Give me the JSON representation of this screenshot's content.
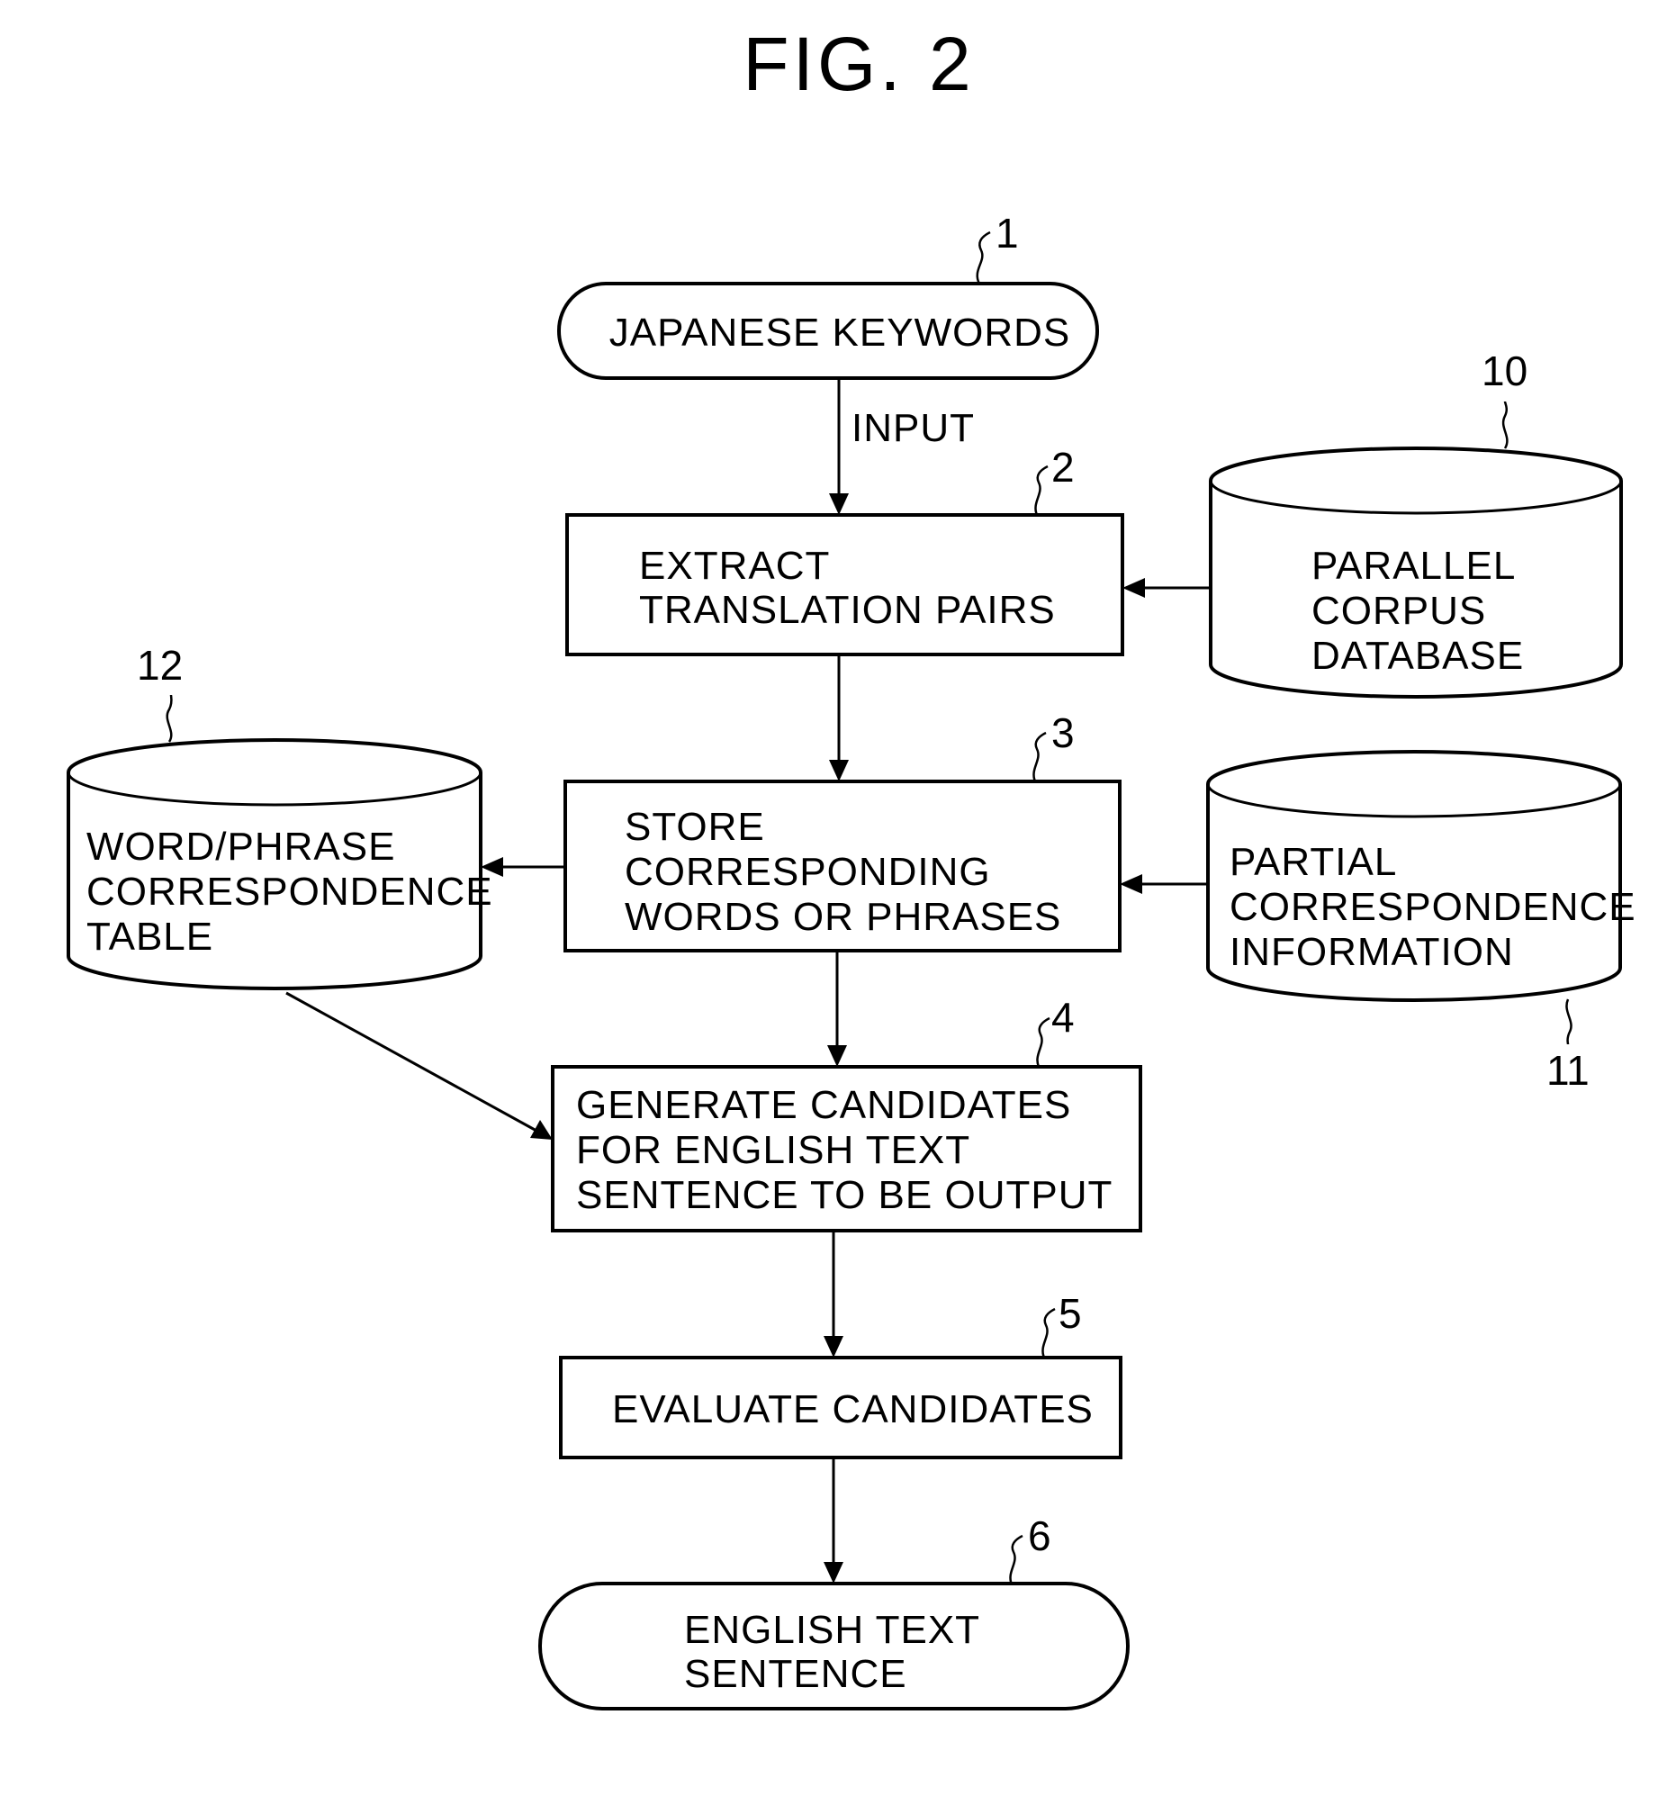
{
  "figure": {
    "title": "FIG. 2"
  },
  "nodes": {
    "n1": {
      "ref": "1",
      "kind": "terminator",
      "lines": [
        "JAPANESE KEYWORDS"
      ]
    },
    "n2": {
      "ref": "2",
      "kind": "process",
      "lines": [
        "EXTRACT",
        "TRANSLATION PAIRS"
      ]
    },
    "n3": {
      "ref": "3",
      "kind": "process",
      "lines": [
        "STORE",
        "CORRESPONDING",
        "WORDS OR PHRASES"
      ]
    },
    "n4": {
      "ref": "4",
      "kind": "process",
      "lines": [
        "GENERATE CANDIDATES",
        "FOR ENGLISH TEXT",
        "SENTENCE TO BE OUTPUT"
      ]
    },
    "n5": {
      "ref": "5",
      "kind": "process",
      "lines": [
        "EVALUATE CANDIDATES"
      ]
    },
    "n6": {
      "ref": "6",
      "kind": "terminator",
      "lines": [
        "ENGLISH TEXT",
        "SENTENCE"
      ]
    },
    "n10": {
      "ref": "10",
      "kind": "database",
      "lines": [
        "PARALLEL",
        "CORPUS",
        "DATABASE"
      ]
    },
    "n11": {
      "ref": "11",
      "kind": "database",
      "lines": [
        "PARTIAL",
        "CORRESPONDENCE",
        "INFORMATION"
      ]
    },
    "n12": {
      "ref": "12",
      "kind": "database",
      "lines": [
        "WORD/PHRASE",
        "CORRESPONDENCE",
        "TABLE"
      ]
    }
  },
  "edges": [
    {
      "from": "1",
      "to": "2",
      "label": "INPUT"
    },
    {
      "from": "10",
      "to": "2",
      "label": ""
    },
    {
      "from": "2",
      "to": "3",
      "label": ""
    },
    {
      "from": "11",
      "to": "3",
      "label": ""
    },
    {
      "from": "3",
      "to": "12",
      "label": ""
    },
    {
      "from": "3",
      "to": "4",
      "label": ""
    },
    {
      "from": "12",
      "to": "4",
      "label": ""
    },
    {
      "from": "4",
      "to": "5",
      "label": ""
    },
    {
      "from": "5",
      "to": "6",
      "label": ""
    }
  ]
}
